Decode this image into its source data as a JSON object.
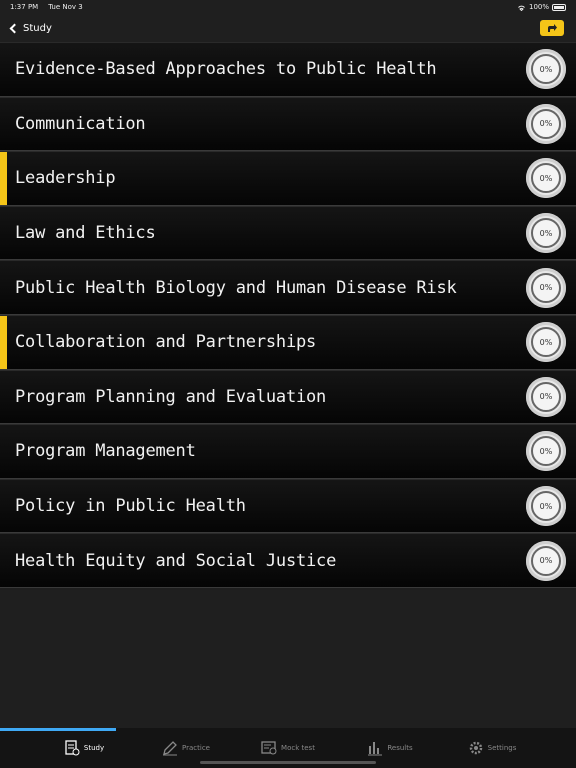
{
  "status": {
    "time": "1:37 PM",
    "date": "Tue Nov 3",
    "battery": "100%"
  },
  "nav": {
    "back_label": "Study"
  },
  "topics": [
    {
      "title": "Evidence-Based Approaches to Public Health",
      "progress": "0%",
      "highlight": false
    },
    {
      "title": "Communication",
      "progress": "0%",
      "highlight": false
    },
    {
      "title": "Leadership",
      "progress": "0%",
      "highlight": true
    },
    {
      "title": "Law and Ethics",
      "progress": "0%",
      "highlight": false
    },
    {
      "title": "Public Health Biology and Human Disease Risk",
      "progress": "0%",
      "highlight": false
    },
    {
      "title": "Collaboration and Partnerships",
      "progress": "0%",
      "highlight": true
    },
    {
      "title": "Program Planning and Evaluation",
      "progress": "0%",
      "highlight": false
    },
    {
      "title": "Program Management",
      "progress": "0%",
      "highlight": false
    },
    {
      "title": "Policy in Public Health",
      "progress": "0%",
      "highlight": false
    },
    {
      "title": "Health Equity and Social Justice",
      "progress": "0%",
      "highlight": false
    }
  ],
  "tabs": [
    {
      "label": "Study",
      "icon": "study-icon",
      "active": true
    },
    {
      "label": "Practice",
      "icon": "pencil-icon",
      "active": false
    },
    {
      "label": "Mock test",
      "icon": "mock-test-icon",
      "active": false
    },
    {
      "label": "Results",
      "icon": "bar-chart-icon",
      "active": false
    },
    {
      "label": "Settings",
      "icon": "gear-icon",
      "active": false
    }
  ],
  "colors": {
    "accent": "#f5c518",
    "tab_indicator": "#3fa9f5"
  }
}
